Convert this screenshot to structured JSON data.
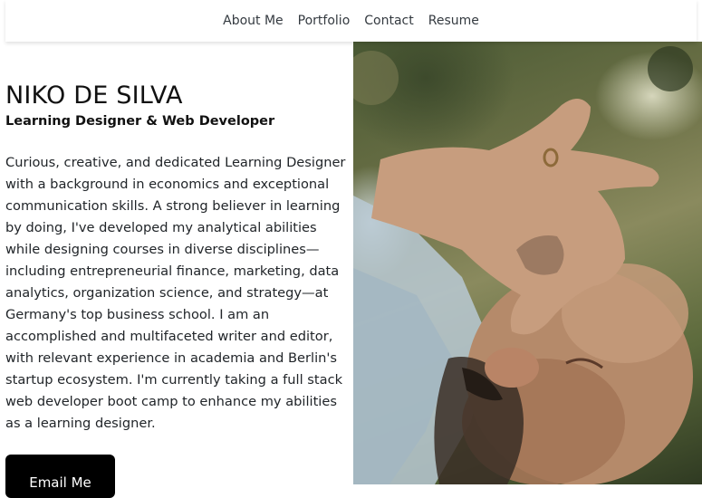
{
  "nav": {
    "items": [
      "About Me",
      "Portfolio",
      "Contact",
      "Resume"
    ]
  },
  "hero": {
    "name": "NIKO DE SILVA",
    "subtitle": "Learning Designer & Web Developer",
    "bio": "Curious, creative, and dedicated Learning Designer with a background in economics and exceptional communication skills. A strong believer in learning by doing, I've developed my analytical abilities while designing courses in diverse disciplines—including entrepreneurial finance, marketing, data analytics, organization science, and strategy—at Germany's top business school. I am an accomplished and multifaceted writer and editor, with relevant experience in academia and Berlin's startup ecosystem. I'm currently taking a full stack web developer boot camp to enhance my abilities as a learning designer.",
    "cta_label": "Email Me"
  },
  "colors": {
    "button_bg": "#000000",
    "button_text": "#ffffff",
    "nav_text": "#343a40"
  }
}
